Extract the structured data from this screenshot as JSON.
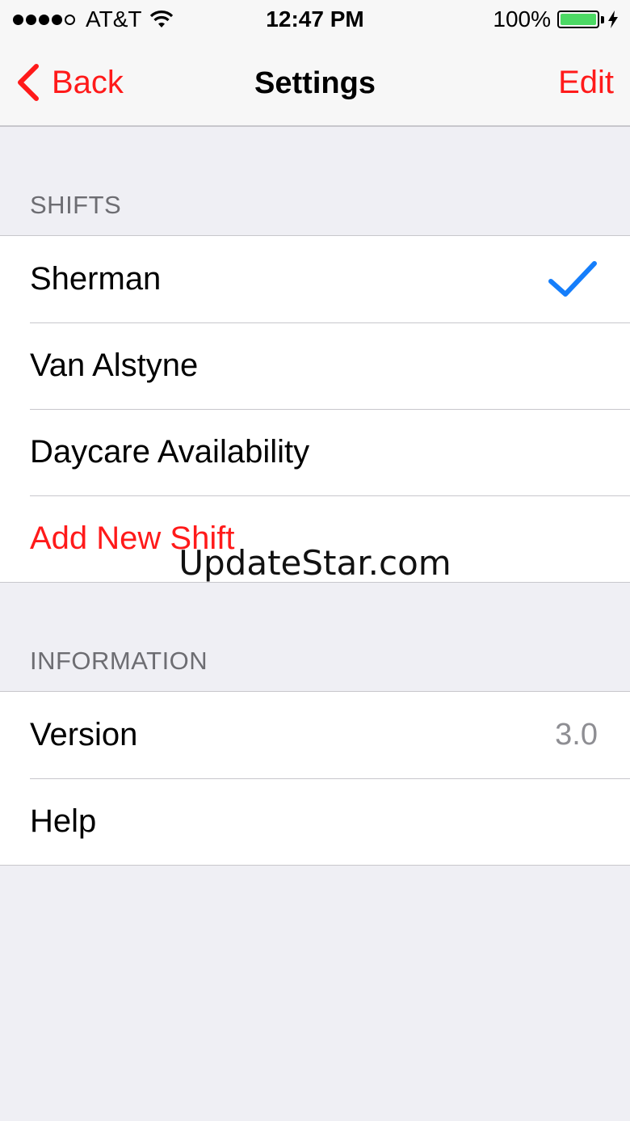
{
  "status_bar": {
    "carrier": "AT&T",
    "time": "12:47 PM",
    "battery_percent": "100%",
    "signal_bars_filled": 4,
    "signal_bars_total": 5,
    "battery_level": 1.0
  },
  "nav": {
    "back_label": "Back",
    "title": "Settings",
    "edit_label": "Edit"
  },
  "sections": {
    "shifts": {
      "header": "SHIFTS",
      "items": [
        {
          "label": "Sherman",
          "selected": true
        },
        {
          "label": "Van Alstyne",
          "selected": false
        },
        {
          "label": "Daycare Availability",
          "selected": false
        }
      ],
      "add_label": "Add New Shift"
    },
    "information": {
      "header": "INFORMATION",
      "version_label": "Version",
      "version_value": "3.0",
      "help_label": "Help"
    }
  },
  "watermark": "UpdateStar.com",
  "colors": {
    "accent": "#ff1a1a",
    "checkmark": "#157efb",
    "battery": "#4cd964",
    "background": "#efeff4"
  }
}
